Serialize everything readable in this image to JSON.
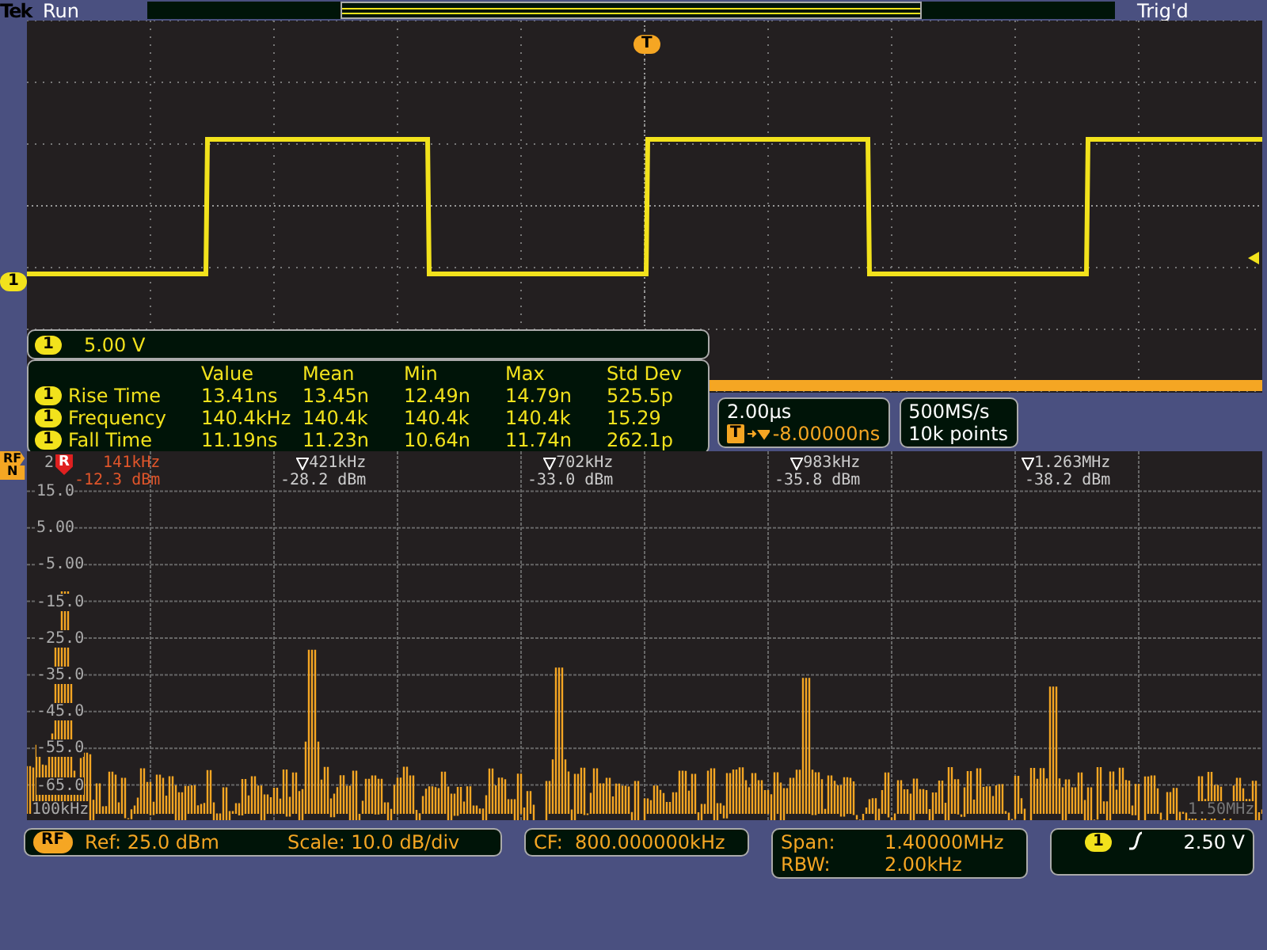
{
  "status_bar": {
    "brand": "Tek",
    "acquisition": "Run",
    "trigger_state": "Trig'd"
  },
  "waveform": {
    "channel_marker": "1",
    "trigger_marker": "T"
  },
  "channel_scale": {
    "channel": "1",
    "scale": "5.00 V"
  },
  "measurements": {
    "columns": [
      "Value",
      "Mean",
      "Min",
      "Max",
      "Std Dev"
    ],
    "rows": [
      {
        "channel": "1",
        "name": "Rise Time",
        "values": [
          "13.41ns",
          "13.45n",
          "12.49n",
          "14.79n",
          "525.5p"
        ]
      },
      {
        "channel": "1",
        "name": "Frequency",
        "values": [
          "140.4kHz",
          "140.4k",
          "140.4k",
          "140.4k",
          "15.29"
        ]
      },
      {
        "channel": "1",
        "name": "Fall Time",
        "values": [
          "11.19ns",
          "11.23n",
          "10.64n",
          "11.74n",
          "262.1p"
        ]
      }
    ]
  },
  "timebase": {
    "scale": "2.00µs",
    "trigger_tag": "T",
    "delay": "-8.00000ns"
  },
  "acquisition": {
    "sample_rate": "500MS/s",
    "record_length": "10k points"
  },
  "rf_tag": {
    "top": "RF",
    "bottom": "N"
  },
  "spectrum": {
    "y_labels": [
      "15.0",
      "5.00",
      "-5.00",
      "-15.0",
      "-25.0",
      "-35.0",
      "-45.0",
      "-55.0",
      "-65.0"
    ],
    "x_start": "100kHz",
    "x_end": "1.50MHz",
    "reference_marker": {
      "index": "2",
      "label": "R",
      "frequency": "141kHz",
      "level": "-12.3 dBm"
    },
    "markers": [
      {
        "frequency": "421kHz",
        "level": "-28.2 dBm"
      },
      {
        "frequency": "702kHz",
        "level": "-33.0 dBm"
      },
      {
        "frequency": "983kHz",
        "level": "-35.8 dBm"
      },
      {
        "frequency": "1.263MHz",
        "level": "-38.2 dBm"
      }
    ]
  },
  "rf_readout": {
    "badge": "RF",
    "ref": "Ref: 25.0 dBm",
    "scale": "Scale: 10.0 dB/div"
  },
  "center_frequency": "CF:  800.000000kHz",
  "span_readout": {
    "span_label": "Span:",
    "span": "1.40000MHz",
    "rbw_label": "RBW:",
    "rbw": "2.00kHz"
  },
  "trigger_readout": {
    "channel": "1",
    "level": "2.50 V"
  }
}
